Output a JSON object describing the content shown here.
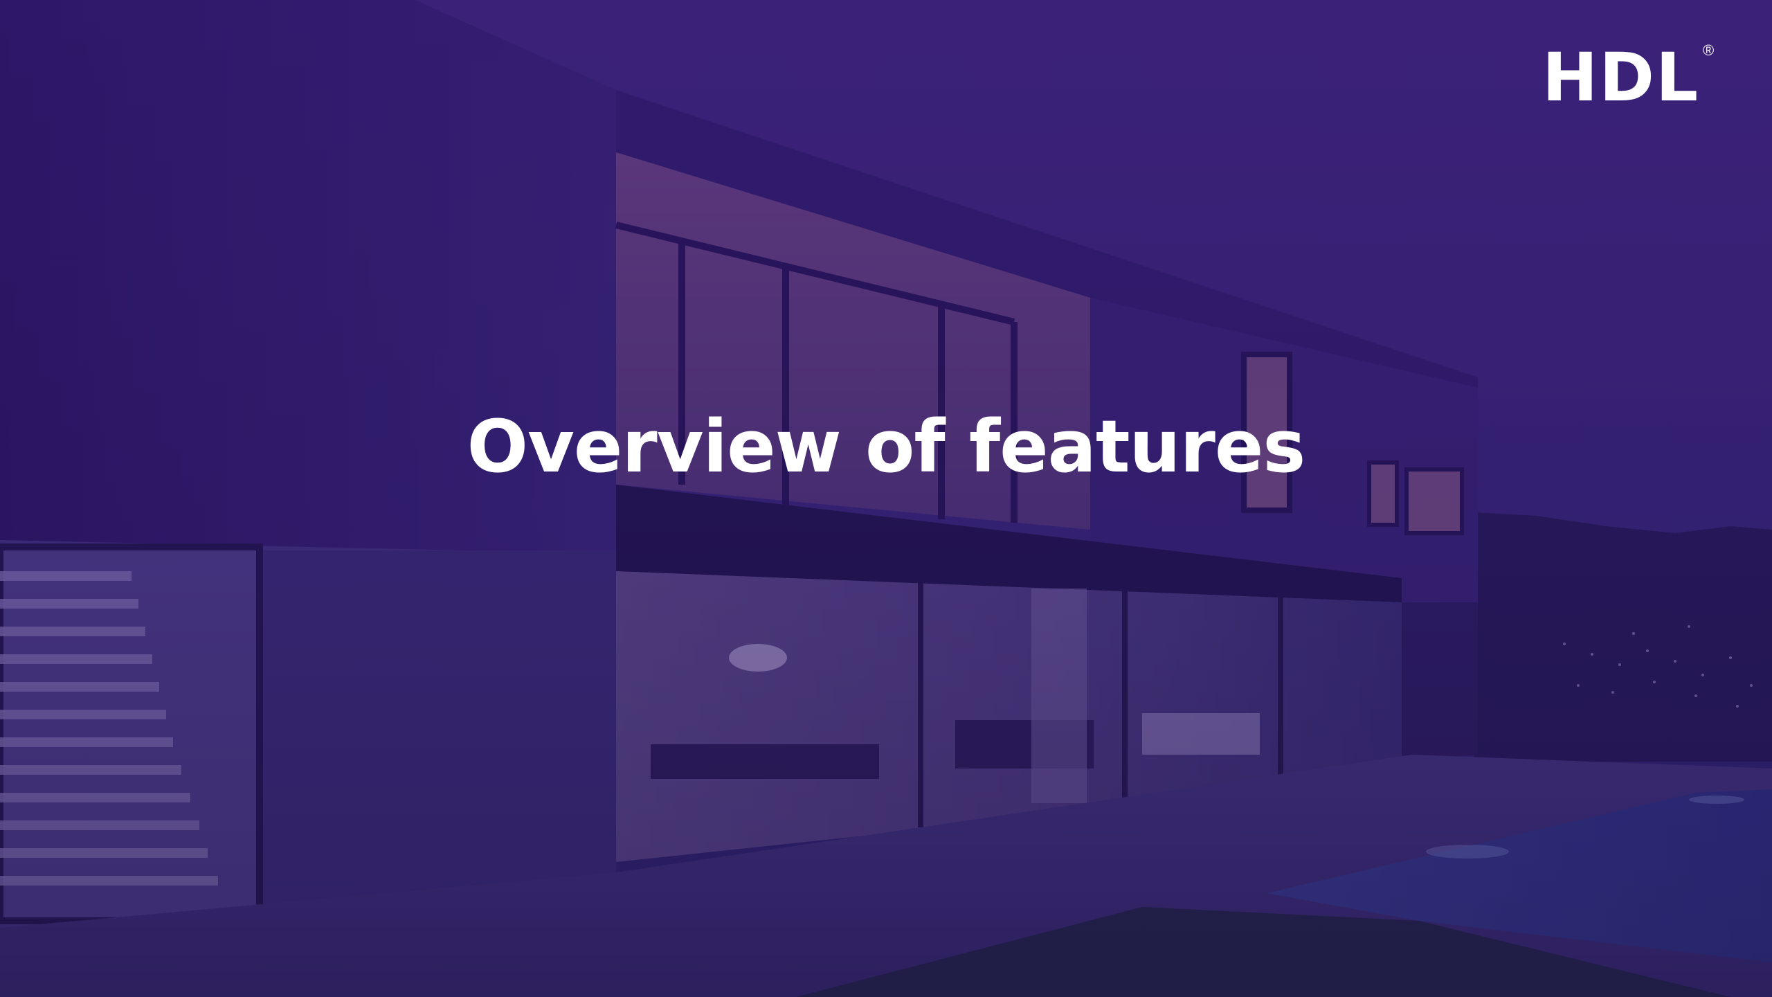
{
  "slide": {
    "title": "Overview of features"
  },
  "brand": {
    "logo_text": "HDL",
    "registered_mark": "®"
  },
  "colors": {
    "overlay_purple": "#30166e",
    "title_text": "#ffffff",
    "logo_text": "#ffffff"
  }
}
